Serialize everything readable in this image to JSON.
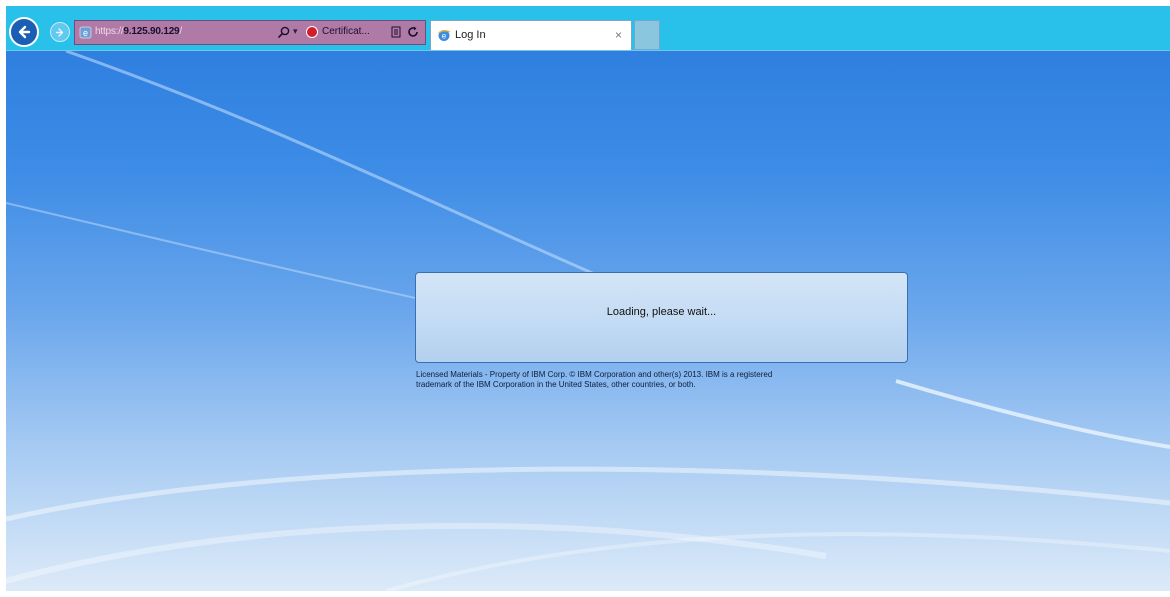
{
  "browser": {
    "address": {
      "scheme": "https://",
      "host": "9.125.90.129",
      "path": "/"
    },
    "certificate_label": "Certificat...",
    "tab": {
      "title": "Log In",
      "close": "×"
    },
    "icons": {
      "back": "arrow-left-icon",
      "forward": "arrow-right-icon",
      "page": "ie-page-icon",
      "search": "search-icon",
      "certificate": "certificate-error-icon",
      "compat": "compatibility-view-icon",
      "refresh": "refresh-icon",
      "tab": "ie-tab-icon"
    },
    "colors": {
      "toolbar": "#29c1ea",
      "address_bar": "#b07aa6",
      "certificate_error": "#d41c2a"
    }
  },
  "page": {
    "loading_text": "Loading, please wait...",
    "license_line1": "Licensed Materials - Property of IBM Corp. © IBM Corporation and other(s) 2013. IBM is a registered",
    "license_line2": "trademark of the IBM Corporation in the United States, other countries, or both."
  }
}
